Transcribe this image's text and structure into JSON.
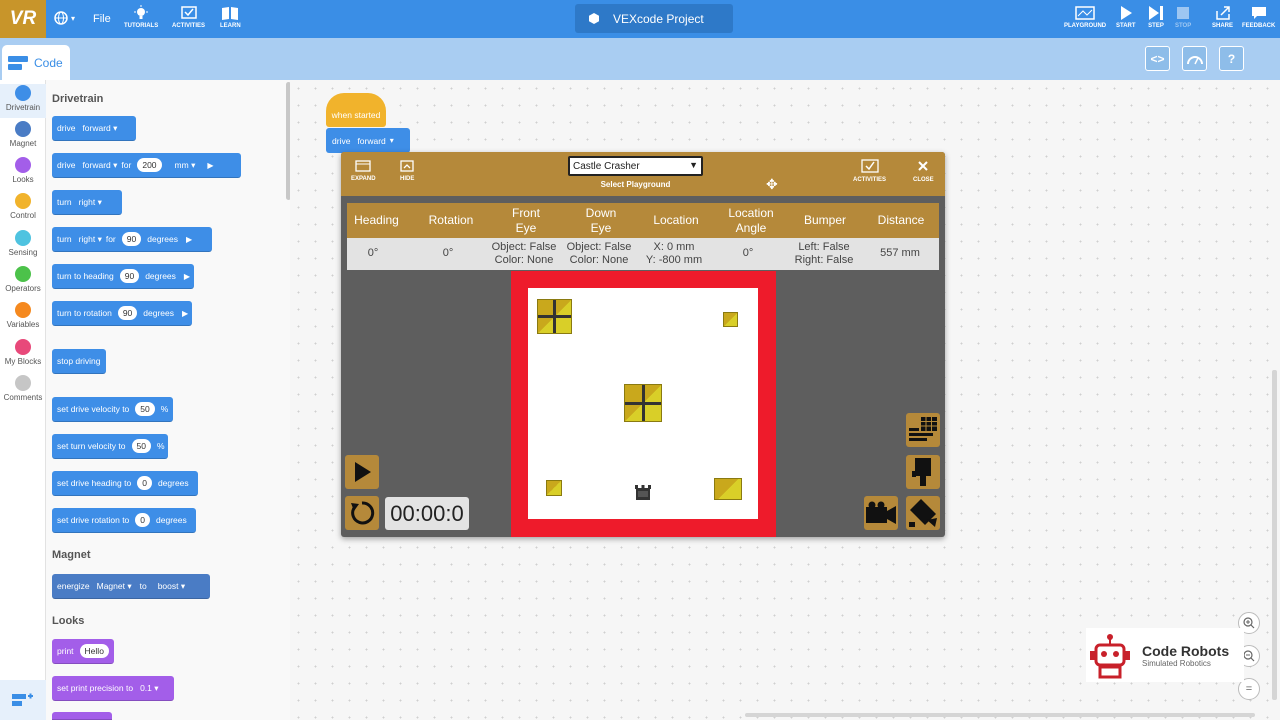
{
  "topbar": {
    "logo": "VR",
    "file": "File",
    "tutorials": "TUTORIALS",
    "activities": "ACTIVITIES",
    "learn": "LEARN",
    "project_title": "VEXcode Project",
    "playground": "PLAYGROUND",
    "start": "START",
    "step": "STEP",
    "stop": "STOP",
    "share": "SHARE",
    "feedback": "FEEDBACK"
  },
  "code_tab": "Code",
  "categories": [
    {
      "label": "Drivetrain",
      "color": "#3e8ee7"
    },
    {
      "label": "Magnet",
      "color": "#4a7cc5"
    },
    {
      "label": "Looks",
      "color": "#a35ee9"
    },
    {
      "label": "Control",
      "color": "#f1b32c"
    },
    {
      "label": "Sensing",
      "color": "#4fc3e0"
    },
    {
      "label": "Operators",
      "color": "#4cc24a"
    },
    {
      "label": "Variables",
      "color": "#f5891f"
    },
    {
      "label": "My Blocks",
      "color": "#e8497a"
    },
    {
      "label": "Comments",
      "color": "#c6c6c6"
    }
  ],
  "palette": {
    "drivetrain_title": "Drivetrain",
    "magnet_title": "Magnet",
    "looks_title": "Looks",
    "b1": {
      "a": "drive",
      "b": "forward"
    },
    "b2": {
      "a": "drive",
      "b": "forward",
      "c": "for",
      "d": "200",
      "e": "mm"
    },
    "b3": {
      "a": "turn",
      "b": "right"
    },
    "b4": {
      "a": "turn",
      "b": "right",
      "c": "for",
      "d": "90",
      "e": "degrees"
    },
    "b5": {
      "a": "turn to heading",
      "b": "90",
      "c": "degrees"
    },
    "b6": {
      "a": "turn to rotation",
      "b": "90",
      "c": "degrees"
    },
    "b7": {
      "a": "stop driving"
    },
    "b8": {
      "a": "set drive velocity to",
      "b": "50",
      "c": "%"
    },
    "b9": {
      "a": "set turn velocity to",
      "b": "50",
      "c": "%"
    },
    "b10": {
      "a": "set drive heading to",
      "b": "0",
      "c": "degrees"
    },
    "b11": {
      "a": "set drive rotation to",
      "b": "0",
      "c": "degrees"
    },
    "b12": {
      "a": "energize",
      "b": "Magnet",
      "c": "to",
      "d": "boost"
    },
    "b13": {
      "a": "print",
      "b": "Hello"
    },
    "b14": {
      "a": "set print precision to",
      "b": "0.1"
    }
  },
  "workspace": {
    "hat": "when started",
    "drive": "drive",
    "forward": "forward"
  },
  "playground": {
    "expand": "EXPAND",
    "hide": "HIDE",
    "selected": "Castle Crasher",
    "select_label": "Select Playground",
    "activities": "ACTIVITIES",
    "close": "CLOSE",
    "headers": [
      "Heading",
      "Rotation",
      "Front Eye",
      "Down Eye",
      "Location",
      "Location Angle",
      "Bumper",
      "Distance"
    ],
    "values": {
      "heading": "0°",
      "rotation": "0°",
      "front1": "Object: False",
      "front2": "Color: None",
      "down1": "Object: False",
      "down2": "Color: None",
      "loc1": "X: 0 mm",
      "loc2": "Y: -800 mm",
      "angle": "0°",
      "bump1": "Left: False",
      "bump2": "Right: False",
      "distance": "557 mm"
    },
    "timer": "00:00:0"
  },
  "watermark": {
    "title": "Code Robots",
    "subtitle": "Simulated Robotics"
  }
}
